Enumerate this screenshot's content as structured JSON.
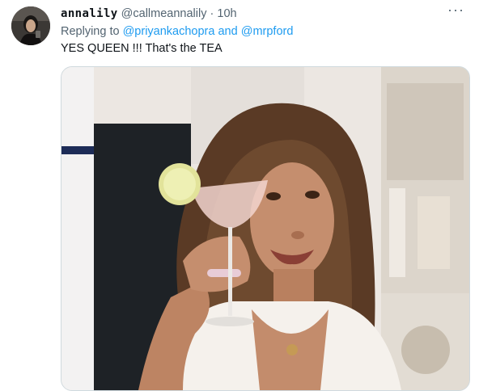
{
  "tweet": {
    "display_name": "annalily",
    "handle": "@callmeannalily",
    "separator": "·",
    "timestamp": "10h",
    "more_label": "···",
    "replying_prefix": "Replying to",
    "mention_1": "@priyankachopra",
    "conjunction": "and",
    "mention_2": "@mrpford",
    "text": "YES QUEEN !!! That's the TEA"
  },
  "colors": {
    "link": "#1d9bf0",
    "secondary_text": "#536471",
    "primary_text": "#0f1419",
    "media_border": "#cfd9de"
  },
  "icons": [
    "more-options-icon"
  ]
}
